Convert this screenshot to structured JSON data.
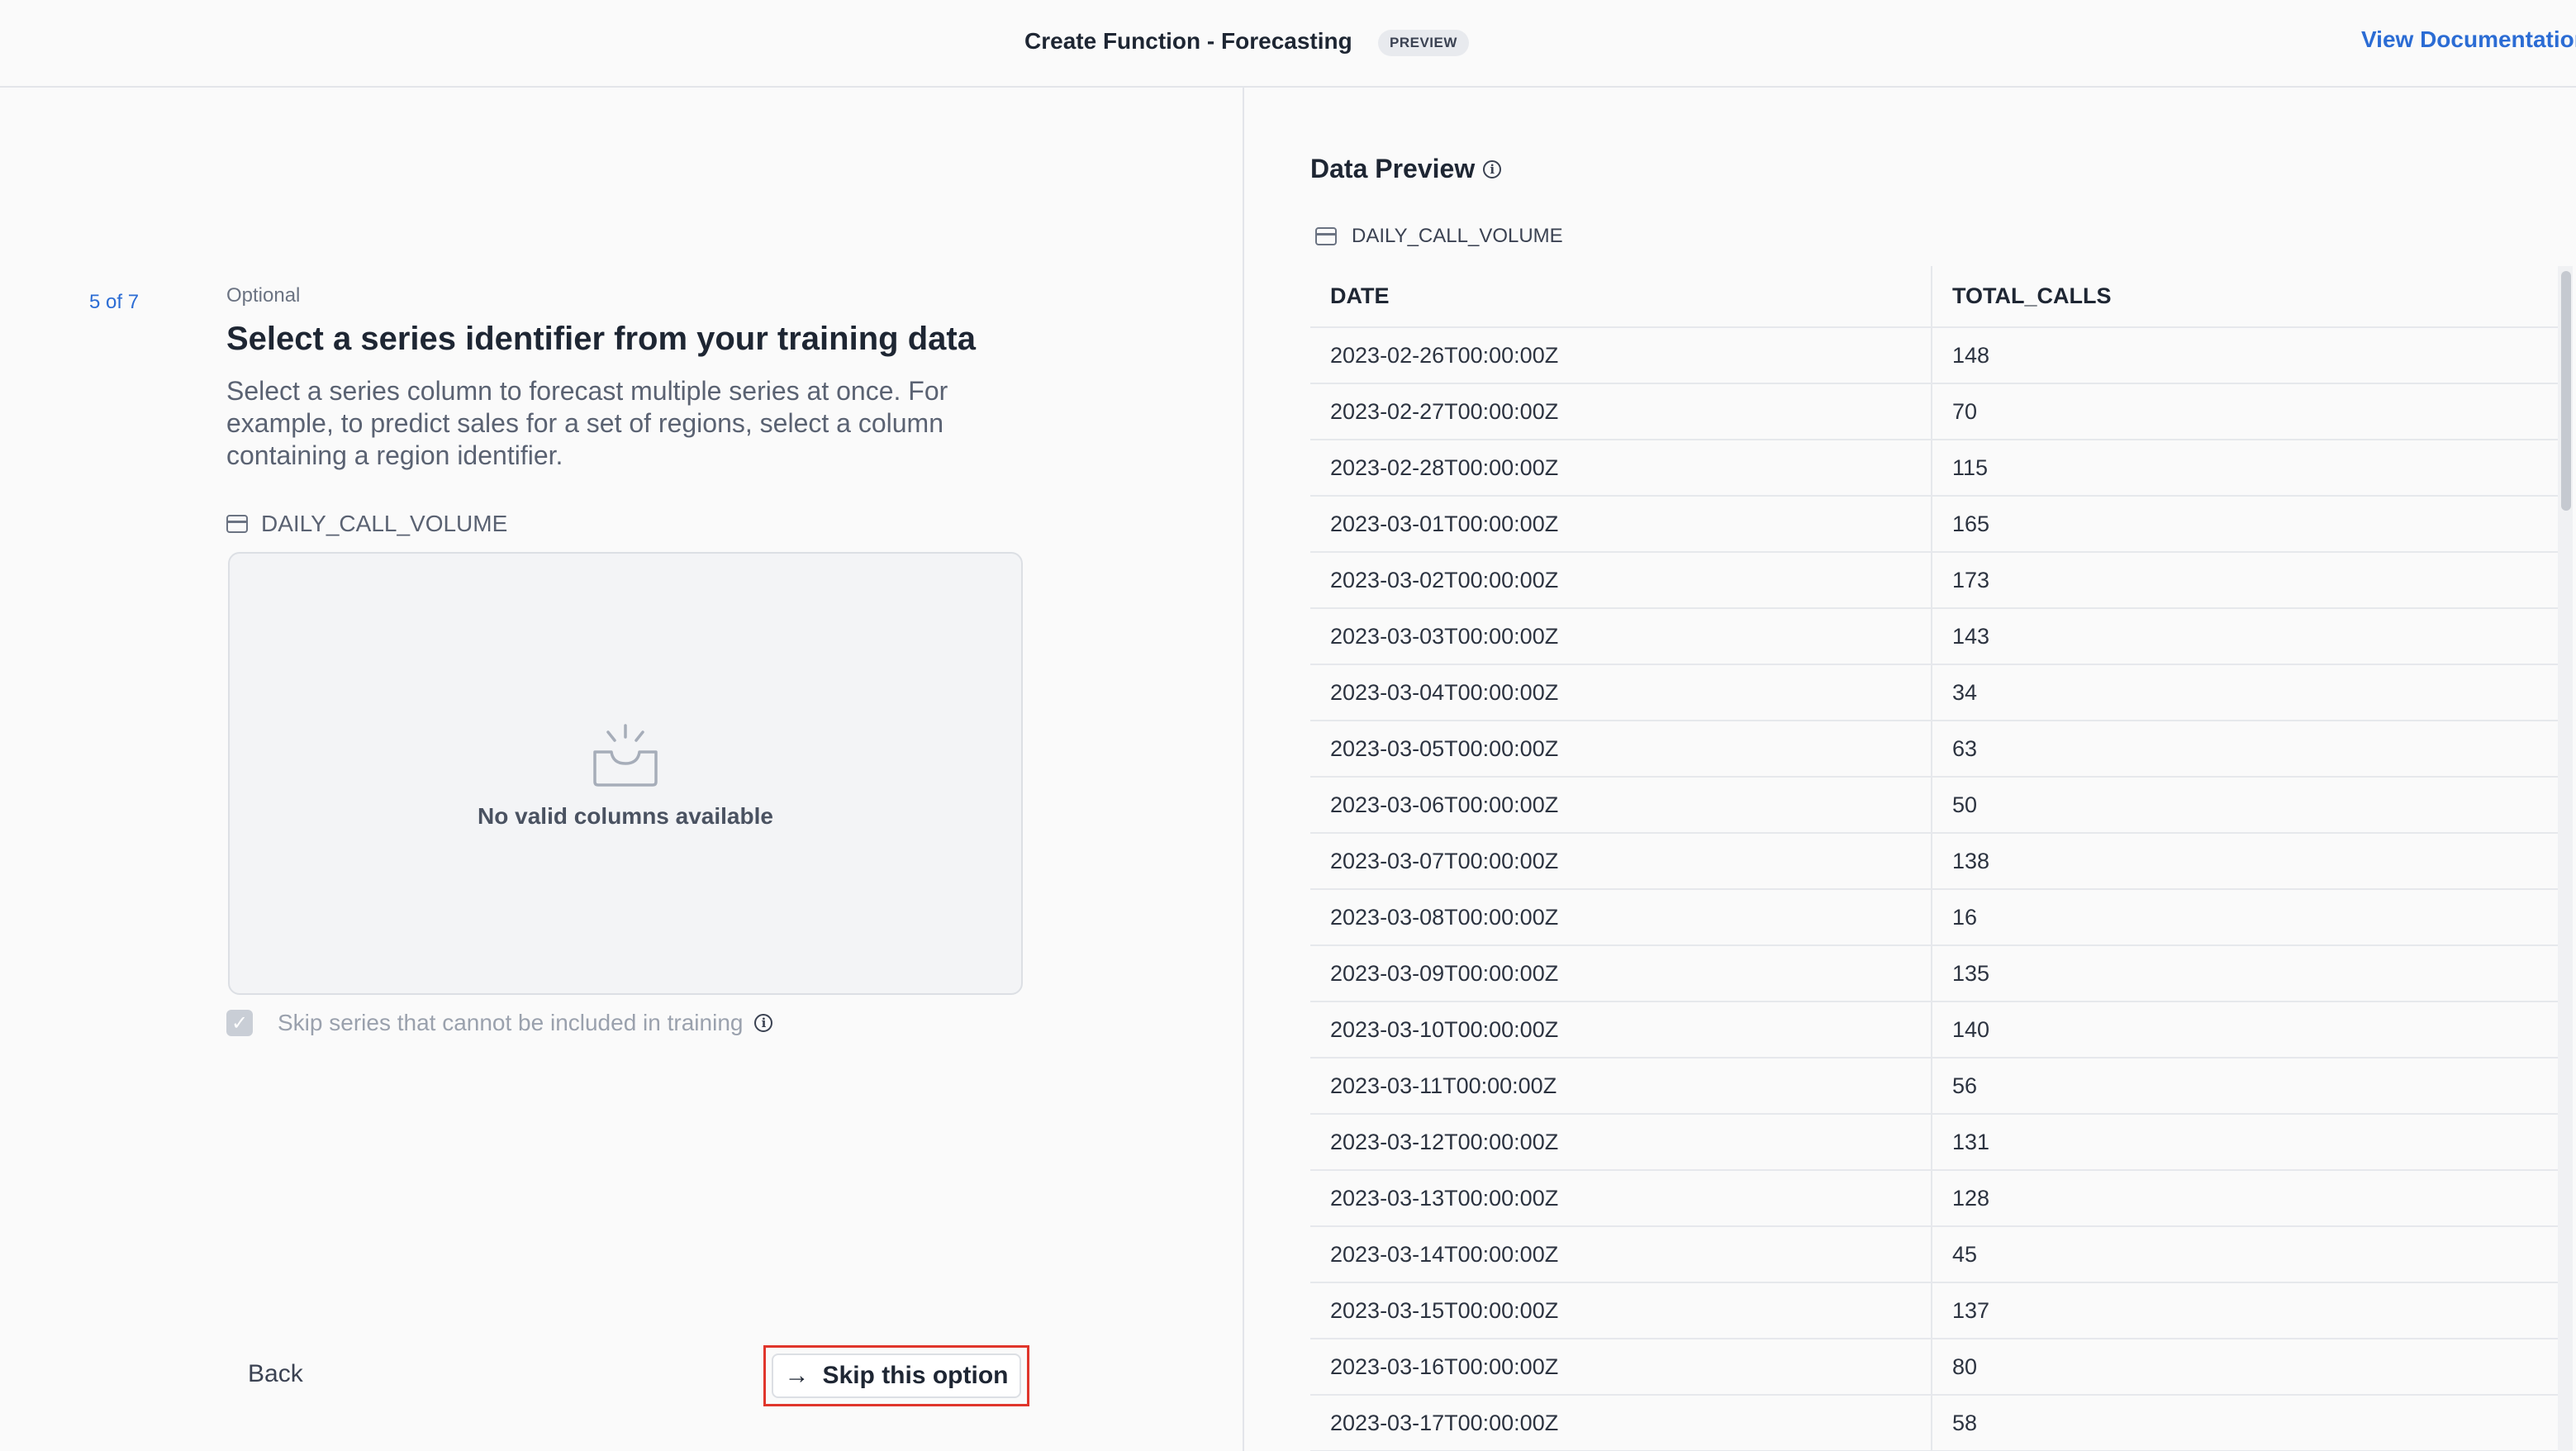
{
  "header": {
    "title": "Create Function - Forecasting",
    "badge": "PREVIEW",
    "doc_link": "View Documentation"
  },
  "wizard": {
    "step": "5 of 7",
    "optional": "Optional",
    "title": "Select a series identifier from your training data",
    "description": "Select a series column to forecast multiple series at once. For example, to predict sales for a set of regions, select a column containing a region identifier.",
    "table_name": "DAILY_CALL_VOLUME",
    "empty_text": "No valid columns available",
    "skip_checkbox_label": "Skip series that cannot be included in training",
    "skip_checkbox_checked": true,
    "back_label": "Back",
    "skip_label": "Skip this option"
  },
  "preview": {
    "title": "Data Preview",
    "table_name": "DAILY_CALL_VOLUME",
    "columns": [
      "DATE",
      "TOTAL_CALLS"
    ],
    "rows": [
      [
        "2023-02-26T00:00:00Z",
        "148"
      ],
      [
        "2023-02-27T00:00:00Z",
        "70"
      ],
      [
        "2023-02-28T00:00:00Z",
        "115"
      ],
      [
        "2023-03-01T00:00:00Z",
        "165"
      ],
      [
        "2023-03-02T00:00:00Z",
        "173"
      ],
      [
        "2023-03-03T00:00:00Z",
        "143"
      ],
      [
        "2023-03-04T00:00:00Z",
        "34"
      ],
      [
        "2023-03-05T00:00:00Z",
        "63"
      ],
      [
        "2023-03-06T00:00:00Z",
        "50"
      ],
      [
        "2023-03-07T00:00:00Z",
        "138"
      ],
      [
        "2023-03-08T00:00:00Z",
        "16"
      ],
      [
        "2023-03-09T00:00:00Z",
        "135"
      ],
      [
        "2023-03-10T00:00:00Z",
        "140"
      ],
      [
        "2023-03-11T00:00:00Z",
        "56"
      ],
      [
        "2023-03-12T00:00:00Z",
        "131"
      ],
      [
        "2023-03-13T00:00:00Z",
        "128"
      ],
      [
        "2023-03-14T00:00:00Z",
        "45"
      ],
      [
        "2023-03-15T00:00:00Z",
        "137"
      ],
      [
        "2023-03-16T00:00:00Z",
        "80"
      ],
      [
        "2023-03-17T00:00:00Z",
        "58"
      ]
    ]
  },
  "colors": {
    "accent": "#2b6cd4",
    "highlight": "#e0352b"
  }
}
